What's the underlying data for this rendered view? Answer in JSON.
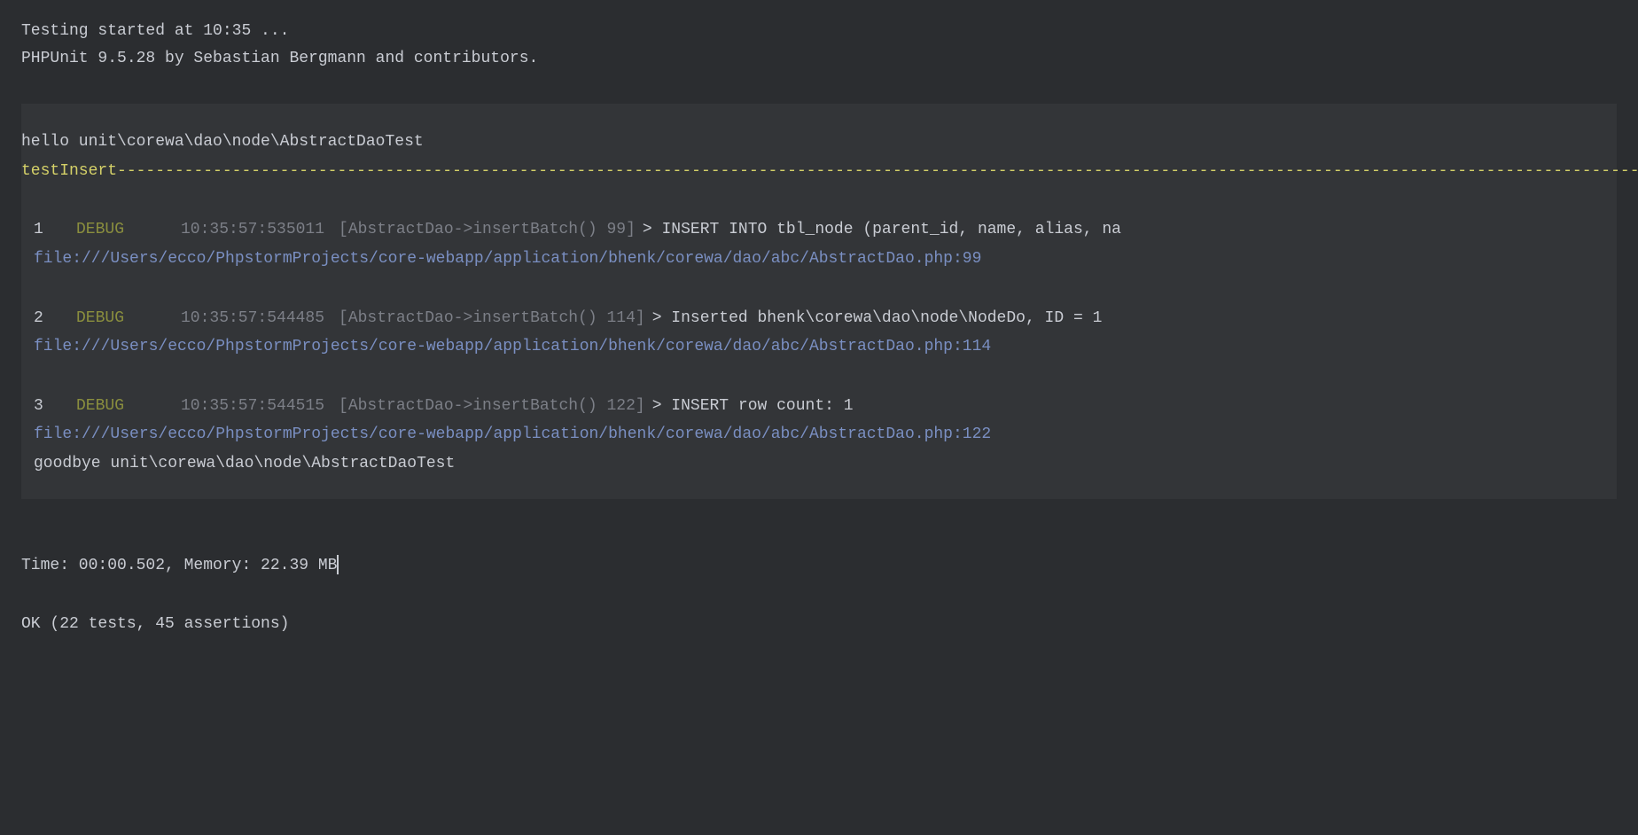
{
  "header": {
    "line1": "Testing started at 10:35 ...",
    "line2": "PHPUnit 9.5.28 by Sebastian Bergmann and contributors."
  },
  "logBlock": {
    "hello": "hello unit\\corewa\\dao\\node\\AbstractDaoTest",
    "testName": "testInsert",
    "dashes": "--------------------------------------------------------------------------------------------------------------------------------------------------------------------------",
    "entries": [
      {
        "num": "1",
        "level": "DEBUG",
        "timestamp": "10:35:57:535011",
        "location": "[AbstractDao->insertBatch() 99]",
        "msg": "> INSERT INTO tbl_node (parent_id, name, alias, na",
        "file": "file:///Users/ecco/PhpstormProjects/core-webapp/application/bhenk/corewa/dao/abc/AbstractDao.php:99"
      },
      {
        "num": "2",
        "level": "DEBUG",
        "timestamp": "10:35:57:544485",
        "location": "[AbstractDao->insertBatch() 114]",
        "msg": "> Inserted bhenk\\corewa\\dao\\node\\NodeDo, ID = 1",
        "file": "file:///Users/ecco/PhpstormProjects/core-webapp/application/bhenk/corewa/dao/abc/AbstractDao.php:114"
      },
      {
        "num": "3",
        "level": "DEBUG",
        "timestamp": "10:35:57:544515",
        "location": "[AbstractDao->insertBatch() 122]",
        "msg": "> INSERT row count: 1",
        "file": "file:///Users/ecco/PhpstormProjects/core-webapp/application/bhenk/corewa/dao/abc/AbstractDao.php:122"
      }
    ],
    "goodbye": "goodbye unit\\corewa\\dao\\node\\AbstractDaoTest"
  },
  "footer": {
    "timeMemory": "Time: 00:00.502, Memory: 22.39 MB",
    "ok": "OK (22 tests, 45 assertions)"
  }
}
